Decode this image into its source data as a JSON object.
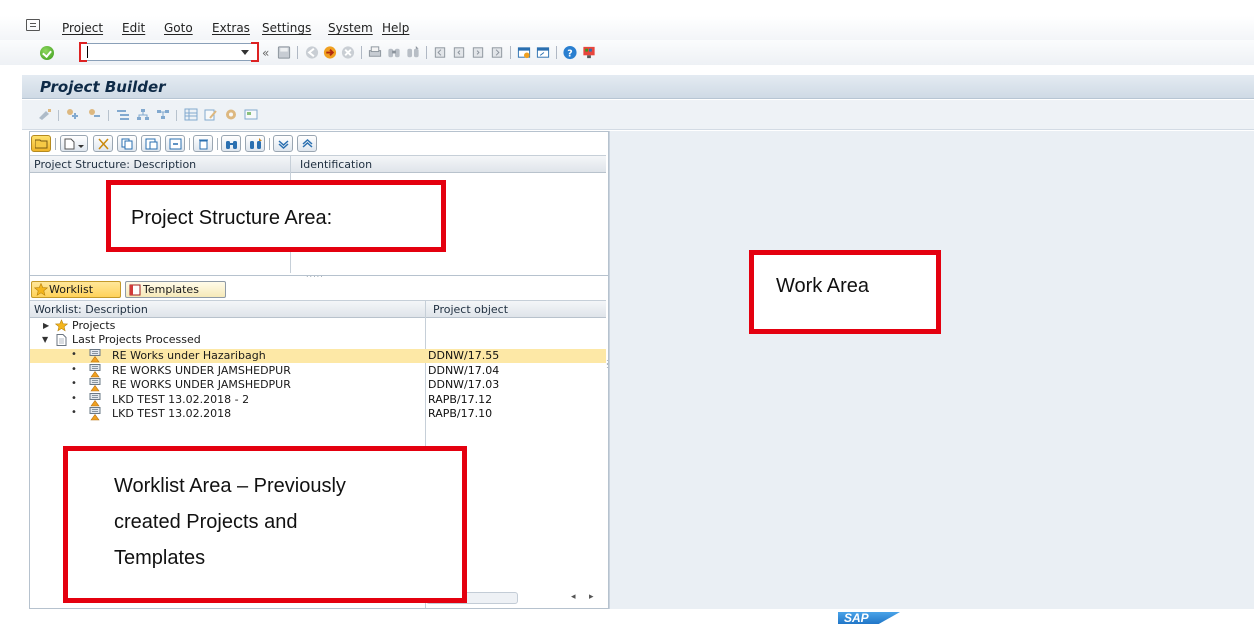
{
  "menu": {
    "items": [
      "Project",
      "Edit",
      "Goto",
      "Extras",
      "Settings",
      "System",
      "Help"
    ]
  },
  "command_field": {
    "value": ""
  },
  "title": "Project Builder",
  "structure_table": {
    "columns": [
      "Project Structure: Description",
      "Identification"
    ]
  },
  "tabs": {
    "worklist": "Worklist",
    "templates": "Templates"
  },
  "worklist_table": {
    "columns": [
      "Worklist: Description",
      "Project object"
    ],
    "nodes": {
      "projects": "Projects",
      "last_processed": "Last Projects Processed"
    },
    "rows": [
      {
        "description": "RE Works under Hazaribagh",
        "object": "DDNW/17.55",
        "selected": true
      },
      {
        "description": "RE WORKS UNDER JAMSHEDPUR",
        "object": "DDNW/17.04",
        "selected": false
      },
      {
        "description": "RE WORKS UNDER JAMSHEDPUR",
        "object": "DDNW/17.03",
        "selected": false
      },
      {
        "description": "LKD TEST 13.02.2018 - 2",
        "object": "RAPB/17.12",
        "selected": false
      },
      {
        "description": "LKD TEST 13.02.2018",
        "object": "RAPB/17.10",
        "selected": false
      }
    ]
  },
  "callouts": {
    "structure": "Project Structure Area:",
    "work": "Work Area",
    "worklist_line1": "Worklist Area – Previously",
    "worklist_line2": "created Projects and",
    "worklist_line3": "Templates"
  },
  "footer": {
    "logo": "SAP"
  },
  "colors": {
    "accent_red": "#e4000f",
    "selection": "#fde8a6",
    "title_text": "#0e2a47",
    "work_area_bg": "#eaeff4"
  }
}
